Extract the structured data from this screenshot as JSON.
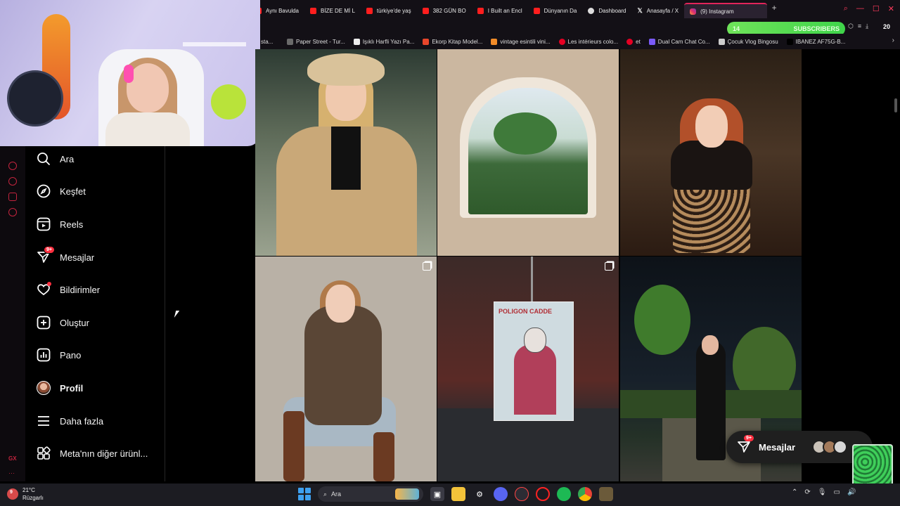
{
  "browser": {
    "tabs": [
      {
        "label": "Aynı Bavulda",
        "kind": "yt"
      },
      {
        "label": "BİZE DE Mİ L",
        "kind": "yt"
      },
      {
        "label": "türkiye'de yaş",
        "kind": "yt"
      },
      {
        "label": "382 GÜN BO",
        "kind": "yt"
      },
      {
        "label": "I Built an Encl",
        "kind": "yt"
      },
      {
        "label": "Dünyanın Da",
        "kind": "yt"
      },
      {
        "label": "Dashboard",
        "kind": "other"
      },
      {
        "label": "Anasayfa / X",
        "kind": "x"
      },
      {
        "label": "(9) Instagram",
        "kind": "ig"
      }
    ],
    "new_tab": "+",
    "bookmarks": [
      {
        "label": "Paper Street - Tur...",
        "color": "#6a6a6a"
      },
      {
        "label": "Işıklı Harfli Yazı Pa...",
        "color": "#eeeeee"
      },
      {
        "label": "Ekorp Kitap Model...",
        "color": "#e8462b"
      },
      {
        "label": "vintage esintili vini...",
        "color": "#f28c28"
      },
      {
        "label": "Les intérieurs colo...",
        "color": "#e60023"
      },
      {
        "label": "et",
        "color": "#e60023"
      },
      {
        "label": "Dual Cam Chat Co...",
        "color": "#7a5af8"
      },
      {
        "label": "Çocuk Vlog Bingosu",
        "color": "#cccccc"
      },
      {
        "label": "IBANEZ AF75G-B...",
        "color": "#000000"
      }
    ],
    "bookmark_prefix": "sta...",
    "subscribers_widget": {
      "left_value": "14",
      "label": "SUBSCRIBERS",
      "count": "20"
    }
  },
  "instagram": {
    "nav": [
      {
        "id": "ara",
        "icon": "search-icon",
        "label": "Ara"
      },
      {
        "id": "kesfet",
        "icon": "compass-icon",
        "label": "Keşfet"
      },
      {
        "id": "reels",
        "icon": "reels-icon",
        "label": "Reels"
      },
      {
        "id": "mesajlar",
        "icon": "messenger-icon",
        "label": "Mesajlar",
        "badge": "9+"
      },
      {
        "id": "bildirimler",
        "icon": "heart-icon",
        "label": "Bildirimler",
        "dot": true
      },
      {
        "id": "olustur",
        "icon": "plus-square-icon",
        "label": "Oluştur"
      },
      {
        "id": "pano",
        "icon": "dashboard-icon",
        "label": "Pano"
      },
      {
        "id": "profil",
        "icon": "avatar",
        "label": "Profil",
        "bold": true
      },
      {
        "id": "daha-fazla",
        "icon": "menu-icon",
        "label": "Daha fazla"
      },
      {
        "id": "meta",
        "icon": "meta-apps-icon",
        "label": "Meta'nın diğer ürünl..."
      }
    ],
    "poster_title": "POLIGON CADDE",
    "messages_pill": {
      "label": "Mesajlar",
      "badge": "9+"
    },
    "accent": "#ff3040"
  },
  "taskbar": {
    "weather_temp": "21°C",
    "weather_desc": "Rüzgarlı",
    "weather_badge": "9",
    "search_label": "Ara"
  }
}
